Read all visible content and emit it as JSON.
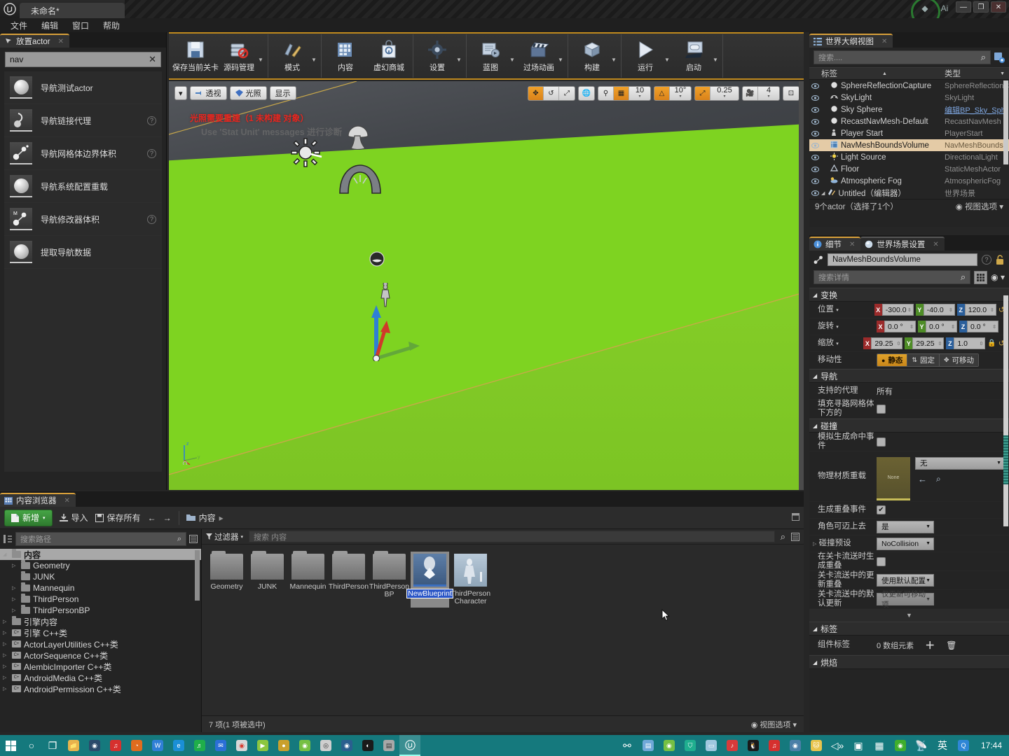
{
  "window": {
    "tab_title": "未命名*",
    "minimize": "—",
    "maximize": "❐",
    "close": "✕"
  },
  "menu": {
    "items": [
      "文件",
      "编辑",
      "窗口",
      "帮助"
    ]
  },
  "place_actors": {
    "tab_label": "放置actor",
    "search_value": "nav",
    "clear_label": "✕",
    "items": [
      {
        "label": "导航测试actor",
        "icon": "sphere-icon",
        "help": false
      },
      {
        "label": "导航链接代理",
        "icon": "nav-link-icon",
        "help": true
      },
      {
        "label": "导航网格体边界体积",
        "icon": "nav-mesh-icon",
        "help": true
      },
      {
        "label": "导航系统配置重载",
        "icon": "sphere-icon",
        "help": false
      },
      {
        "label": "导航修改器体积",
        "icon": "nav-modifier-icon",
        "help": true
      },
      {
        "label": "提取导航数据",
        "icon": "sphere-icon",
        "help": false
      }
    ]
  },
  "toolbar": {
    "groups": [
      {
        "buttons": [
          {
            "label": "保存当前关卡",
            "icon": "save-icon",
            "caret": false
          },
          {
            "label": "源码管理",
            "icon": "source-control-icon",
            "caret": true
          }
        ]
      },
      {
        "buttons": [
          {
            "label": "模式",
            "icon": "modes-icon",
            "caret": true
          }
        ]
      },
      {
        "buttons": [
          {
            "label": "内容",
            "icon": "content-icon",
            "caret": false
          },
          {
            "label": "虚幻商城",
            "icon": "marketplace-icon",
            "caret": false
          }
        ]
      },
      {
        "buttons": [
          {
            "label": "设置",
            "icon": "settings-icon",
            "caret": true
          }
        ]
      },
      {
        "buttons": [
          {
            "label": "蓝图",
            "icon": "blueprint-icon",
            "caret": true
          },
          {
            "label": "过场动画",
            "icon": "cinematics-icon",
            "caret": true
          }
        ]
      },
      {
        "buttons": [
          {
            "label": "构建",
            "icon": "build-icon",
            "caret": true
          }
        ]
      },
      {
        "buttons": [
          {
            "label": "运行",
            "icon": "play-icon",
            "caret": true
          },
          {
            "label": "启动",
            "icon": "launch-icon",
            "caret": true
          }
        ]
      }
    ]
  },
  "viewport": {
    "left_buttons": [
      {
        "label": "透视",
        "icon": "camera-icon"
      },
      {
        "label": "光照",
        "icon": "lit-icon"
      },
      {
        "label": "显示",
        "icon": "show-icon"
      }
    ],
    "warning_text": "光照需要重建（1 未构建 对象）",
    "watermark_text": "Use 'Stat Unit' messages 进行诊断",
    "transform_tools": [
      "select-translate-icon",
      "rotate-icon",
      "scale-icon"
    ],
    "coord_icon": "world-coord-icon",
    "surface_snap_icon": "surface-snap-icon",
    "grid_snap_icon": "grid-snap-icon",
    "grid_snap_value": "10",
    "rotate_snap_icon": "rotate-snap-icon",
    "rotate_snap_value": "10°",
    "scale_snap_icon": "scale-snap-icon",
    "scale_snap_value": "0.25",
    "camera_speed_icon": "camera-speed-icon",
    "camera_speed_value": "4",
    "maximize_icon": "maximize-viewport-icon",
    "axis_labels": [
      "z",
      "y",
      "x"
    ]
  },
  "outliner": {
    "tab_label": "世界大纲视图",
    "search_placeholder": "搜索....",
    "search_icon": "magnifier-icon",
    "add_icon": "add-actor-icon",
    "col_label": "标签",
    "col_type": "类型",
    "rows": [
      {
        "name": "Untitled（编辑器）",
        "type": "世界场景",
        "depth": 0,
        "icon": "level-icon",
        "selected": false,
        "link": false
      },
      {
        "name": "Atmospheric Fog",
        "type": "AtmosphericFog",
        "depth": 1,
        "icon": "fog-icon",
        "selected": false,
        "link": false
      },
      {
        "name": "Floor",
        "type": "StaticMeshActor",
        "depth": 1,
        "icon": "mesh-icon",
        "selected": false,
        "link": false
      },
      {
        "name": "Light Source",
        "type": "DirectionalLight",
        "depth": 1,
        "icon": "light-icon",
        "selected": false,
        "link": false
      },
      {
        "name": "NavMeshBoundsVolume",
        "type": "NavMeshBoundsV",
        "depth": 1,
        "icon": "volume-icon",
        "selected": true,
        "link": false
      },
      {
        "name": "Player Start",
        "type": "PlayerStart",
        "depth": 1,
        "icon": "playerstart-icon",
        "selected": false,
        "link": false
      },
      {
        "name": "RecastNavMesh-Default",
        "type": "RecastNavMesh",
        "depth": 1,
        "icon": "sphere-icon",
        "selected": false,
        "link": false
      },
      {
        "name": "Sky Sphere",
        "type": "编辑BP_Sky_Sph",
        "depth": 1,
        "icon": "sphere-icon",
        "selected": false,
        "link": true
      },
      {
        "name": "SkyLight",
        "type": "SkyLight",
        "depth": 1,
        "icon": "skylight-icon",
        "selected": false,
        "link": false
      },
      {
        "name": "SphereReflectionCapture",
        "type": "SphereReflectionC",
        "depth": 1,
        "icon": "sphere-icon",
        "selected": false,
        "link": false
      }
    ],
    "footer_count": "9个actor（选择了1个）",
    "footer_view_options": "视图选项"
  },
  "details": {
    "tab_details": "细节",
    "tab_world_settings": "世界场景设置",
    "object_name": "NavMeshBoundsVolume",
    "search_placeholder": "搜索详情",
    "lock_icon": "lock-icon",
    "grid_icon": "grid-view-icon",
    "eye_icon": "eye-icon",
    "sections": {
      "transform": {
        "title": "变换",
        "location_label": "位置",
        "location": {
          "x": "-300.0",
          "y": "-40.0",
          "z": "120.0"
        },
        "rotation_label": "旋转",
        "rotation": {
          "x": "0.0 °",
          "y": "0.0 °",
          "z": "0.0 °"
        },
        "scale_label": "缩放",
        "scale": {
          "x": "29.25",
          "y": "29.25",
          "z": "1.0"
        },
        "mobility_label": "移动性",
        "mobility_options": [
          "静态",
          "固定",
          "可移动"
        ],
        "mobility_selected": "静态"
      },
      "navigation": {
        "title": "导航",
        "rows": [
          {
            "label": "支持的代理",
            "value": "所有",
            "type": "text"
          },
          {
            "label": "填充寻路网格体下方的",
            "value": "",
            "type": "checkbox",
            "checked": false
          }
        ]
      },
      "collision": {
        "title": "碰撞",
        "rows": [
          {
            "label": "模拟生成命中事件",
            "type": "checkbox",
            "checked": false
          },
          {
            "label": "物理材质重载",
            "type": "material",
            "thumb_label": "None",
            "value": "无"
          },
          {
            "label": "生成重叠事件",
            "type": "checkbox",
            "checked": true
          },
          {
            "label": "角色可迈上去",
            "type": "dropdown",
            "value": "是"
          },
          {
            "label": "碰撞预设",
            "type": "dropdown-expandable",
            "value": "NoCollision"
          },
          {
            "label": "在关卡流送时生成重叠",
            "type": "checkbox",
            "checked": false
          },
          {
            "label": "关卡流送中的更新重叠",
            "type": "dropdown",
            "value": "使用默认配置"
          },
          {
            "label": "关卡流送中的默认更新",
            "type": "dropdown",
            "value": "仅更新可移动项"
          }
        ]
      },
      "tags": {
        "title": "标签",
        "row_label": "组件标签",
        "row_value": "0 数组元素",
        "add_icon": "plus-icon",
        "delete_icon": "trash-icon"
      },
      "bake": {
        "title": "烘焙"
      }
    }
  },
  "content_browser": {
    "tab_label": "内容浏览器",
    "add_label": "新增",
    "import_label": "导入",
    "save_all_label": "保存所有",
    "back_icon": "arrow-left-icon",
    "forward_icon": "arrow-right-icon",
    "breadcrumb": "内容",
    "path_search_placeholder": "搜索路径",
    "filter_label": "过滤器",
    "asset_search_placeholder": "搜索 内容",
    "tree": [
      {
        "label": "内容",
        "depth": 0,
        "arrow": true,
        "selected": true,
        "kind": "folder"
      },
      {
        "label": "Geometry",
        "depth": 1,
        "arrow": true,
        "selected": false,
        "kind": "folder"
      },
      {
        "label": "JUNK",
        "depth": 1,
        "arrow": false,
        "selected": false,
        "kind": "folder"
      },
      {
        "label": "Mannequin",
        "depth": 1,
        "arrow": true,
        "selected": false,
        "kind": "folder"
      },
      {
        "label": "ThirdPerson",
        "depth": 1,
        "arrow": true,
        "selected": false,
        "kind": "folder"
      },
      {
        "label": "ThirdPersonBP",
        "depth": 1,
        "arrow": true,
        "selected": false,
        "kind": "folder"
      },
      {
        "label": "引擎内容",
        "depth": 0,
        "arrow": true,
        "selected": false,
        "kind": "folder"
      },
      {
        "label": "引擎 C++类",
        "depth": 0,
        "arrow": true,
        "selected": false,
        "kind": "cpp"
      },
      {
        "label": "ActorLayerUtilities C++类",
        "depth": 0,
        "arrow": true,
        "selected": false,
        "kind": "cpp"
      },
      {
        "label": "ActorSequence C++类",
        "depth": 0,
        "arrow": true,
        "selected": false,
        "kind": "cpp"
      },
      {
        "label": "AlembicImporter C++类",
        "depth": 0,
        "arrow": true,
        "selected": false,
        "kind": "cpp"
      },
      {
        "label": "AndroidMedia C++类",
        "depth": 0,
        "arrow": true,
        "selected": false,
        "kind": "cpp"
      },
      {
        "label": "AndroidPermission C++类",
        "depth": 0,
        "arrow": true,
        "selected": false,
        "kind": "cpp"
      }
    ],
    "assets": [
      {
        "name": "Geometry",
        "type": "folder",
        "selected": false
      },
      {
        "name": "JUNK",
        "type": "folder",
        "selected": false
      },
      {
        "name": "Mannequin",
        "type": "folder",
        "selected": false
      },
      {
        "name": "ThirdPerson",
        "type": "folder",
        "selected": false
      },
      {
        "name": "ThirdPerson BP",
        "type": "folder",
        "selected": false
      },
      {
        "name": "NewBlueprint",
        "type": "blueprint",
        "selected": true,
        "renaming": true
      },
      {
        "name": "ThirdPerson Character",
        "type": "character",
        "selected": false
      }
    ],
    "footer_count": "7 项(1 项被选中)",
    "footer_view_options": "视图选项"
  },
  "taskbar": {
    "clock": "17:44",
    "ime_label": "英",
    "left_icons": [
      "start-icon",
      "cortana-icon",
      "task-view-icon",
      "explorer-icon",
      "steam-icon",
      "netease-icon",
      "firefox-icon",
      "wps-icon",
      "edge-icon",
      "qqmusic-icon",
      "foxmail-icon",
      "chrome-icon",
      "player-icon",
      "yy-icon",
      "android-icon",
      "weibo-icon",
      "steam2-icon",
      "opera-icon",
      "pdf-icon",
      "unreal-icon"
    ],
    "tray_icons": [
      "network-share-icon",
      "printer-icon",
      "android-icon",
      "shield-icon",
      "monitor-icon",
      "music-icon",
      "penguin-icon",
      "netease-icon",
      "steam-icon",
      "cat-icon",
      "volume-icon",
      "display-icon",
      "keyboard-icon",
      "nvidia-icon",
      "satellite-icon"
    ]
  },
  "colors": {
    "accent_orange": "#c08a1e",
    "selection_tan": "#e4cba6",
    "ground_green": "#7ed321",
    "taskbar_teal": "#15797d",
    "warning_red": "#e8261f"
  }
}
